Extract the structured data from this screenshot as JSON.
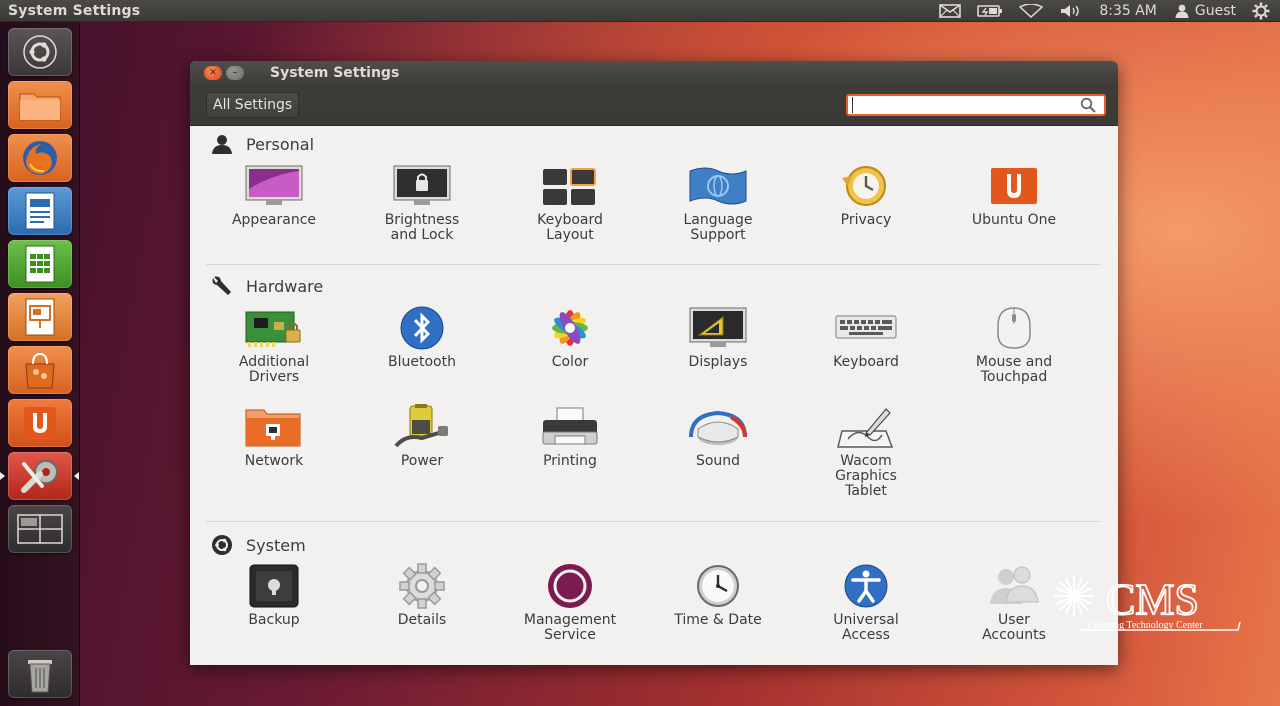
{
  "top_panel": {
    "app_title": "System Settings",
    "clock": "8:35 AM",
    "user": "Guest",
    "icons": [
      "mail-icon",
      "battery-icon",
      "wifi-icon",
      "volume-icon",
      "user-icon",
      "gear-icon"
    ]
  },
  "launcher": {
    "items": [
      "dash-home",
      "files",
      "firefox",
      "writer",
      "calc",
      "impress",
      "software-center",
      "ubuntu-one",
      "system-settings",
      "workspaces",
      "trash"
    ]
  },
  "window": {
    "title": "System Settings",
    "toolbar": {
      "all_settings": "All Settings",
      "search_placeholder": ""
    },
    "sections": {
      "personal": {
        "title": "Personal",
        "items": [
          "Appearance",
          "Brightness\nand Lock",
          "Keyboard\nLayout",
          "Language\nSupport",
          "Privacy",
          "Ubuntu One"
        ]
      },
      "hardware": {
        "title": "Hardware",
        "items": [
          "Additional\nDrivers",
          "Bluetooth",
          "Color",
          "Displays",
          "Keyboard",
          "Mouse and\nTouchpad",
          "Network",
          "Power",
          "Printing",
          "Sound",
          "Wacom\nGraphics\nTablet"
        ]
      },
      "system": {
        "title": "System",
        "items": [
          "Backup",
          "Details",
          "Management\nService",
          "Time & Date",
          "Universal\nAccess",
          "User\nAccounts"
        ]
      }
    }
  },
  "watermark": {
    "text": "CMS",
    "subtext": "Learning Technology Center"
  },
  "colors": {
    "accent": "#e8602a",
    "panel": "#3c3b37",
    "window_bg": "#f2f1f0"
  }
}
